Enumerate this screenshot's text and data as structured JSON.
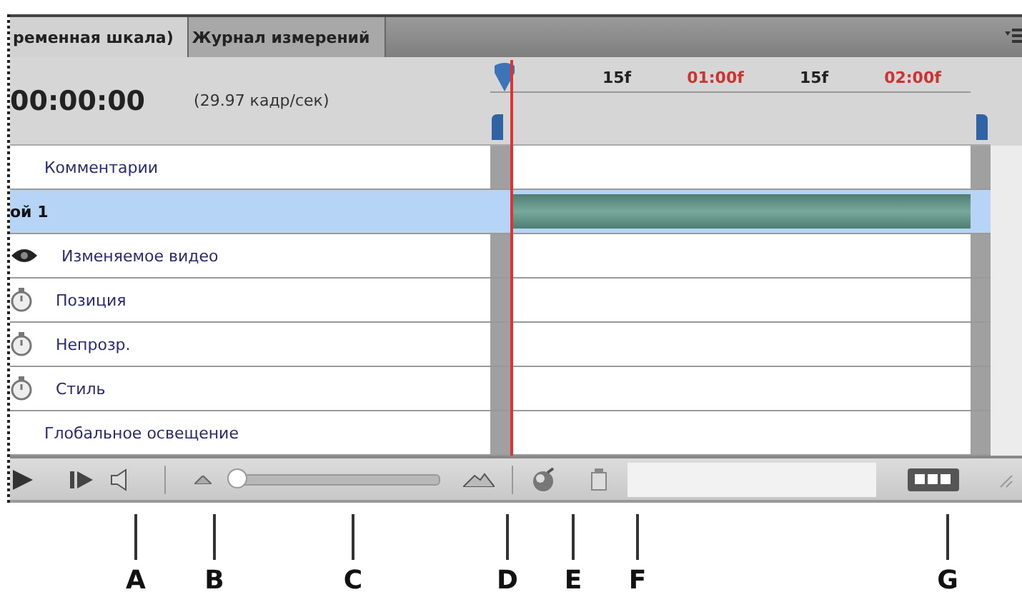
{
  "tabs": [
    {
      "label": "ременная шкала)",
      "selected": true
    },
    {
      "label": "Журнал измерений",
      "selected": false
    }
  ],
  "header": {
    "timecode": "00:00:00",
    "frame_rate": "(29.97 кадр/сек)"
  },
  "ruler": {
    "ticks": [
      {
        "label": "15f",
        "color": "#222222"
      },
      {
        "label": "01:00f",
        "color": "#cc3333"
      },
      {
        "label": "15f",
        "color": "#222222"
      },
      {
        "label": "02:00f",
        "color": "#cc3333"
      }
    ]
  },
  "rows": [
    {
      "kind": "group",
      "label": "Комментарии",
      "selected": false
    },
    {
      "kind": "layer",
      "label": "ой 1",
      "selected": true
    },
    {
      "kind": "video",
      "label": "Изменяемое видео",
      "selected": false
    },
    {
      "kind": "property",
      "label": "Позиция",
      "selected": false
    },
    {
      "kind": "property",
      "label": "Непрозр.",
      "selected": false
    },
    {
      "kind": "property",
      "label": "Стиль",
      "selected": false
    },
    {
      "kind": "group",
      "label": "Глобальное освещение",
      "selected": false
    }
  ],
  "toolbar": {
    "zoom": {
      "level": 0.03
    }
  },
  "callouts": [
    {
      "letter": "A"
    },
    {
      "letter": "B"
    },
    {
      "letter": "C"
    },
    {
      "letter": "D"
    },
    {
      "letter": "E"
    },
    {
      "letter": "F"
    },
    {
      "letter": "G"
    }
  ]
}
